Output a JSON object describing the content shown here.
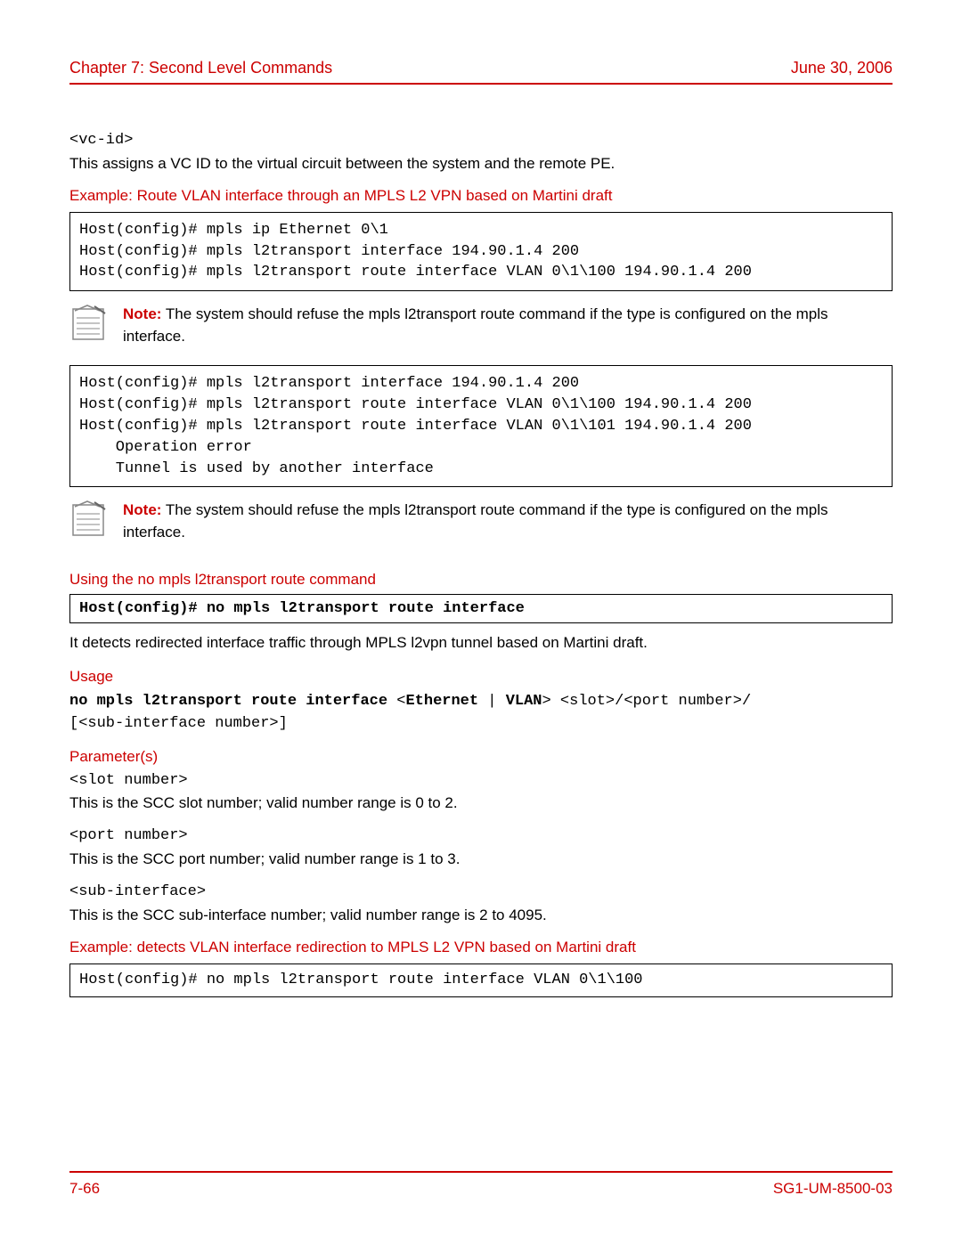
{
  "header": {
    "chapter": "Chapter 7: Second Level Commands",
    "date": "June 30, 2006"
  },
  "sec1": {
    "vc_id": "<vc-id>",
    "vc_id_desc": "This assigns a VC ID to the virtual circuit between the system and the remote PE.",
    "example_heading": "Example: Route VLAN interface through an MPLS L2 VPN based on Martini draft",
    "codebox": "Host(config)# mpls ip Ethernet 0\\1\nHost(config)# mpls l2transport interface 194.90.1.4 200\nHost(config)# mpls l2transport route interface VLAN 0\\1\\100 194.90.1.4 200"
  },
  "note_common": {
    "label": "Note:",
    "text": " The system should refuse the mpls l2transport route command if the type is configured on the mpls interface."
  },
  "codebox2": "Host(config)# mpls l2transport interface 194.90.1.4 200\nHost(config)# mpls l2transport route interface VLAN 0\\1\\100 194.90.1.4 200\nHost(config)# mpls l2transport route interface VLAN 0\\1\\101 194.90.1.4 200\n    Operation error\n    Tunnel is used by another interface",
  "sec2": {
    "heading": "Using the no mpls l2transport route command",
    "box_cmd": "Host(config)# no mpls l2transport route interface",
    "desc": "It detects redirected interface traffic through MPLS l2vpn tunnel based on Martini draft.",
    "usage_label": "Usage",
    "usage_bold": "no mpls l2transport route interface",
    "usage_eth_vlan_open": " <",
    "usage_eth": "Ethernet",
    "usage_pipe": " | ",
    "usage_vlan": "VLAN",
    "usage_rest": "> <slot>/<port number>/\n[<sub-interface number>]",
    "params_label": "Parameter(s)",
    "params": [
      {
        "name": "<slot number>",
        "desc": "This is the SCC slot number; valid number range is 0 to 2."
      },
      {
        "name": "<port number>",
        "desc": "This is the SCC port number; valid number range is 1 to 3."
      },
      {
        "name": "<sub-interface>",
        "desc": "This is the SCC sub-interface number; valid number range is 2 to 4095."
      }
    ],
    "example_heading": "Example: detects VLAN interface redirection to MPLS L2 VPN based on Martini draft",
    "example_box": "Host(config)# no mpls l2transport route interface VLAN 0\\1\\100"
  },
  "footer": {
    "page": "7-66",
    "docid": "SG1-UM-8500-03"
  }
}
